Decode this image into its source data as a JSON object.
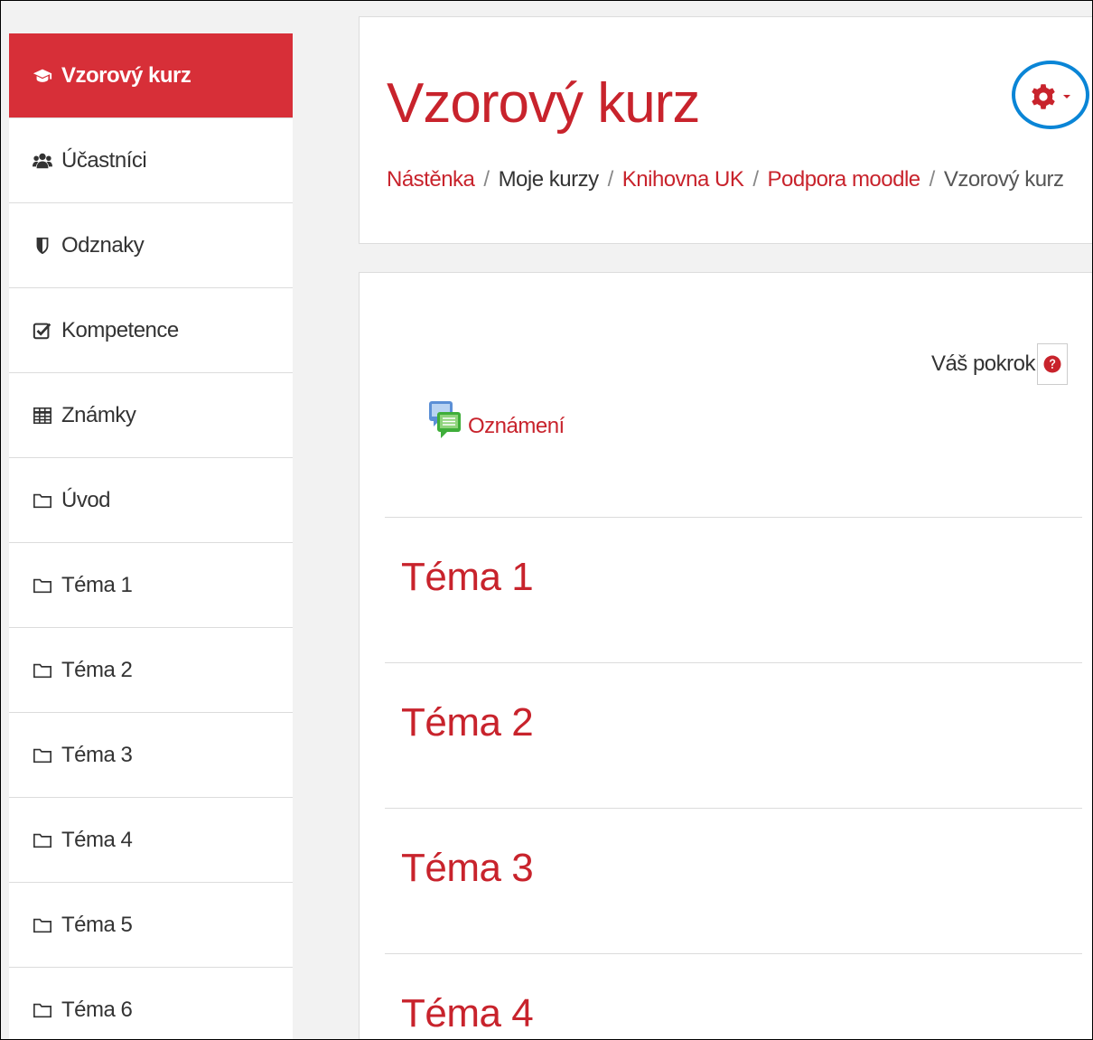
{
  "sidebar": {
    "items": [
      {
        "label": "Vzorový kurz",
        "icon": "graduation-cap-icon",
        "active": true
      },
      {
        "label": "Účastníci",
        "icon": "users-icon"
      },
      {
        "label": "Odznaky",
        "icon": "shield-icon"
      },
      {
        "label": "Kompetence",
        "icon": "checkbox-icon"
      },
      {
        "label": "Známky",
        "icon": "table-icon"
      },
      {
        "label": "Úvod",
        "icon": "folder-icon"
      },
      {
        "label": "Téma 1",
        "icon": "folder-icon"
      },
      {
        "label": "Téma 2",
        "icon": "folder-icon"
      },
      {
        "label": "Téma 3",
        "icon": "folder-icon"
      },
      {
        "label": "Téma 4",
        "icon": "folder-icon"
      },
      {
        "label": "Téma 5",
        "icon": "folder-icon"
      },
      {
        "label": "Téma 6",
        "icon": "folder-icon"
      }
    ]
  },
  "header": {
    "title": "Vzorový kurz",
    "breadcrumb": {
      "dashboard": "Nástěnka",
      "my_courses": "Moje kurzy",
      "library": "Knihovna UK",
      "support": "Podpora moodle",
      "current": "Vzorový kurz",
      "separator": "/"
    },
    "settings_icon": "gear-icon",
    "highlight_color": "#0a85d6"
  },
  "main": {
    "progress_label": "Váš pokrok",
    "announcement_label": "Oznámení",
    "sections": [
      "Téma 1",
      "Téma 2",
      "Téma 3",
      "Téma 4"
    ]
  },
  "colors": {
    "accent": "#c8232c",
    "active_bg": "#d72f38"
  }
}
